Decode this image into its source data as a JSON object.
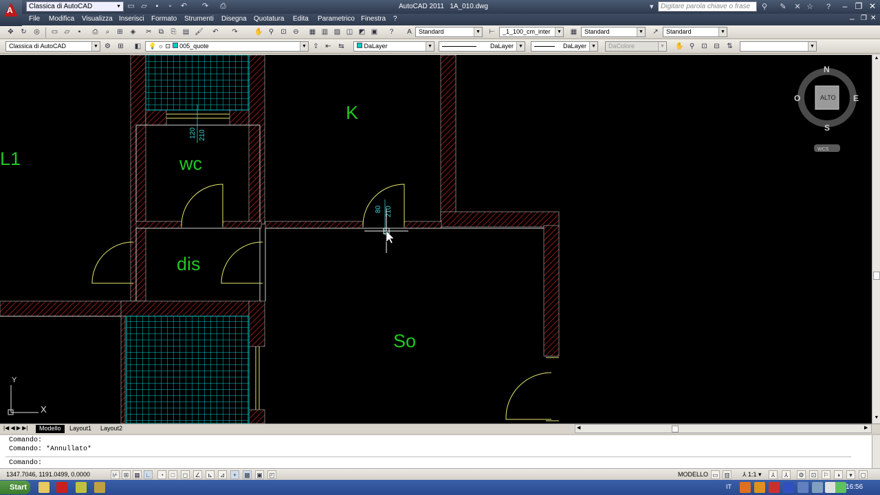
{
  "app": {
    "workspace": "Classica di AutoCAD",
    "title_app": "AutoCAD 2011",
    "title_file": "1A_010.dwg",
    "search_placeholder": "Digitare parola chiave o frase"
  },
  "menu": [
    "File",
    "Modifica",
    "Visualizza",
    "Inserisci",
    "Formato",
    "Strumenti",
    "Disegna",
    "Quotatura",
    "Edita",
    "Parametrico",
    "Finestra",
    "?"
  ],
  "toolbar1": {
    "text_style": "Standard",
    "dim_style": "_1_100_cm_inter",
    "table_style": "Standard",
    "mleader_style": "Standard"
  },
  "toolbar2": {
    "workspace": "Classica di AutoCAD",
    "layer": "005_quote",
    "color": "DaLayer",
    "linetype": "DaLayer",
    "lineweight": "DaLayer",
    "plotstyle": "DaColore",
    "extra": ""
  },
  "drawing": {
    "rooms": [
      "K",
      "wc",
      "dis",
      "So",
      "L1"
    ],
    "door_dims": [
      {
        "w": "120",
        "h": "210"
      },
      {
        "w": "80",
        "h": "210"
      }
    ]
  },
  "viewcube": {
    "n": "N",
    "s": "S",
    "e": "E",
    "w": "O",
    "face": "ALTO",
    "wcs": "WCS"
  },
  "ucs": {
    "x": "X",
    "y": "Y"
  },
  "tabs": [
    "Modello",
    "Layout1",
    "Layout2"
  ],
  "command": {
    "line1": "Comando:",
    "line2": "Comando: *Annullato*",
    "prompt": "Comando:"
  },
  "status": {
    "coords": "1347.7046, 1191.0499, 0.0000",
    "space": "MODELLO",
    "scale": "1:1"
  },
  "taskbar": {
    "start": "Start",
    "lang": "IT",
    "time": "16:56"
  },
  "colors": {
    "hatch": "#b02020",
    "door": "#e8e870",
    "tile": "#00c8c8",
    "room_text": "#20c820",
    "dim": "#40d0d0"
  }
}
